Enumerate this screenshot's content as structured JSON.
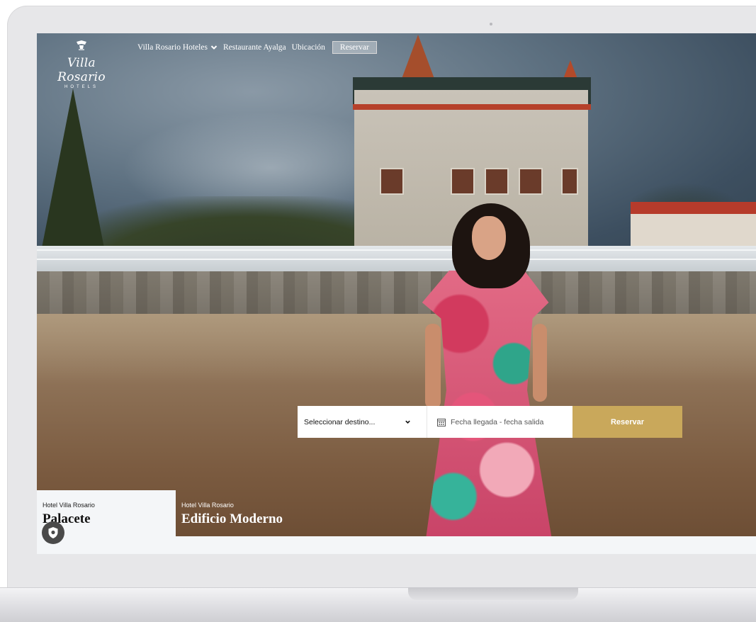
{
  "logo": {
    "crest_icon": "crest-icon",
    "name": "Villa Rosario",
    "subtitle": "HOTELS"
  },
  "nav": {
    "items": [
      {
        "label": "Villa Rosario Hoteles",
        "icon": "chevron-down-icon"
      },
      {
        "label": "Restaurante Ayalga"
      },
      {
        "label": "Ubicación"
      }
    ],
    "reserve_label": "Reservar"
  },
  "booking": {
    "destination_placeholder": "Seleccionar destino...",
    "dates_placeholder": "Fecha llegada - fecha salida",
    "calendar_icon": "calendar-icon",
    "submit_label": "Reservar",
    "accent_color": "#c9a85b"
  },
  "properties": [
    {
      "brand": "Hotel Villa Rosario",
      "name": "Palacete",
      "active": true
    },
    {
      "brand": "Hotel Villa Rosario",
      "name": "Edificio Moderno",
      "active": false
    }
  ],
  "privacy_badge": {
    "icon": "shield-icon"
  }
}
